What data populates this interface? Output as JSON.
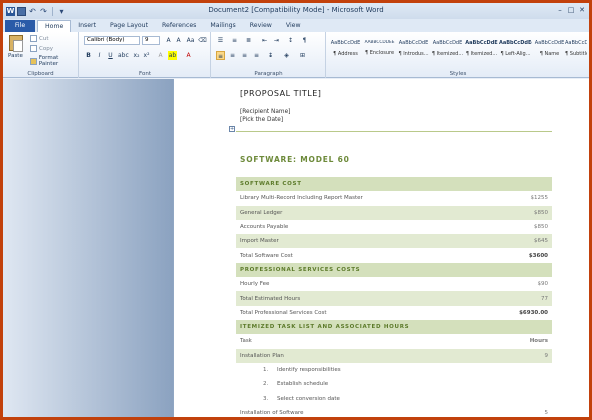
{
  "window": {
    "title": "Document2 [Compatibility Mode] - Microsoft Word"
  },
  "tabs": [
    "File",
    "Home",
    "Insert",
    "Page Layout",
    "References",
    "Mailings",
    "Review",
    "View"
  ],
  "ribbon": {
    "clipboard": {
      "paste": "Paste",
      "cut": "Cut",
      "copy": "Copy",
      "format_painter": "Format Painter",
      "label": "Clipboard"
    },
    "font": {
      "name": "Calibri (Body)",
      "size": "9",
      "label": "Font"
    },
    "paragraph": {
      "label": "Paragraph"
    },
    "styles": {
      "label": "Styles",
      "items": [
        {
          "preview": "AaBbCcDdE",
          "name": "¶ Address"
        },
        {
          "preview": "AABBCCDDEE",
          "name": "¶ Enclosure"
        },
        {
          "preview": "AaBbCcDdE",
          "name": "¶ Introdus..."
        },
        {
          "preview": "AaBbCcDdE",
          "name": "¶ Itemized..."
        },
        {
          "preview": "AaBbCcDdE",
          "name": "¶ Itemized..."
        },
        {
          "preview": "AaBbCcDdEe",
          "name": "¶ Left-Alig..."
        },
        {
          "preview": "AaBbCcDdE",
          "name": "¶ Name"
        },
        {
          "preview": "AaBbCcDdEe",
          "name": "¶ Subtitle"
        }
      ]
    }
  },
  "document": {
    "proposal_title": "[PROPOSAL TITLE]",
    "recipient": "[Recipient Name]",
    "date": "[Pick the Date]",
    "heading": "SOFTWARE: MODEL 60",
    "rows": [
      {
        "type": "section",
        "label": "SOFTWARE COST",
        "value": ""
      },
      {
        "type": "plain",
        "label": "Library Multi-Record Including Report Master",
        "value": "$1255"
      },
      {
        "type": "shade",
        "label": "General Ledger",
        "value": "$850"
      },
      {
        "type": "plain",
        "label": "Accounts Payable",
        "value": "$850"
      },
      {
        "type": "shade",
        "label": "Import Master",
        "value": "$645"
      },
      {
        "type": "bold",
        "label": "Total Software Cost",
        "value": "$3600"
      },
      {
        "type": "section",
        "label": "PROFESSIONAL SERVICES COSTS",
        "value": ""
      },
      {
        "type": "plain",
        "label": "Hourly Fee",
        "value": "$90"
      },
      {
        "type": "shade",
        "label": "Total Estimated Hours",
        "value": "77"
      },
      {
        "type": "bold",
        "label": "Total Professional Services Cost",
        "value": "$6930.00"
      },
      {
        "type": "section",
        "label": "ITEMIZED TASK LIST AND ASSOCIATED HOURS",
        "value": ""
      },
      {
        "type": "plain",
        "label": "Task",
        "value": "Hours"
      },
      {
        "type": "shade",
        "label": "Installation Plan",
        "value": "9"
      },
      {
        "type": "sub",
        "num": "1.",
        "label": "Identify responsibilities",
        "value": ""
      },
      {
        "type": "sub",
        "num": "2.",
        "label": "Establish schedule",
        "value": ""
      },
      {
        "type": "sub",
        "num": "3.",
        "label": "Select conversion date",
        "value": ""
      },
      {
        "type": "plain",
        "label": "Installation of Software",
        "value": "5"
      }
    ]
  }
}
